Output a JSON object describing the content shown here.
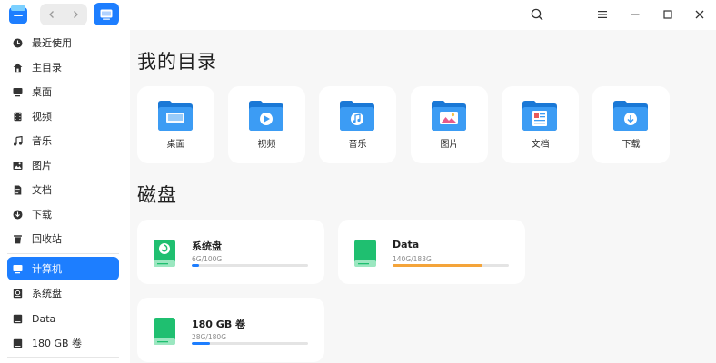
{
  "sidebar": {
    "items": [
      {
        "label": "最近使用",
        "icon": "clock-icon"
      },
      {
        "label": "主目录",
        "icon": "home-icon"
      },
      {
        "label": "桌面",
        "icon": "desktop-icon"
      },
      {
        "label": "视频",
        "icon": "film-icon"
      },
      {
        "label": "音乐",
        "icon": "music-icon"
      },
      {
        "label": "图片",
        "icon": "image-icon"
      },
      {
        "label": "文档",
        "icon": "document-icon"
      },
      {
        "label": "下载",
        "icon": "download-icon"
      },
      {
        "label": "回收站",
        "icon": "trash-icon"
      },
      {
        "label": "计算机",
        "icon": "computer-icon",
        "active": true
      },
      {
        "label": "系统盘",
        "icon": "system-disk-icon"
      },
      {
        "label": "Data",
        "icon": "drive-icon"
      },
      {
        "label": "180 GB 卷",
        "icon": "drive-icon"
      }
    ]
  },
  "main": {
    "directory_title": "我的目录",
    "disks_title": "磁盘",
    "folders": [
      {
        "label": "桌面",
        "glyph": "desktop"
      },
      {
        "label": "视频",
        "glyph": "play"
      },
      {
        "label": "音乐",
        "glyph": "music"
      },
      {
        "label": "图片",
        "glyph": "image"
      },
      {
        "label": "文档",
        "glyph": "document"
      },
      {
        "label": "下载",
        "glyph": "download"
      }
    ],
    "disks": [
      {
        "name": "系统盘",
        "size": "6G/100G",
        "used_fraction": 0.06,
        "bar_color": "#1d7eff",
        "system": true
      },
      {
        "name": "Data",
        "size": "140G/183G",
        "used_fraction": 0.77,
        "bar_color": "#f4a43a",
        "system": false
      },
      {
        "name": "180 GB 卷",
        "size": "28G/180G",
        "used_fraction": 0.155,
        "bar_color": "#1d7eff",
        "system": false
      }
    ]
  },
  "colors": {
    "accent": "#1d7eff",
    "folder_blue": "#2f8ff0",
    "disk_green": "#1fbf70",
    "warning_orange": "#f4a43a"
  }
}
